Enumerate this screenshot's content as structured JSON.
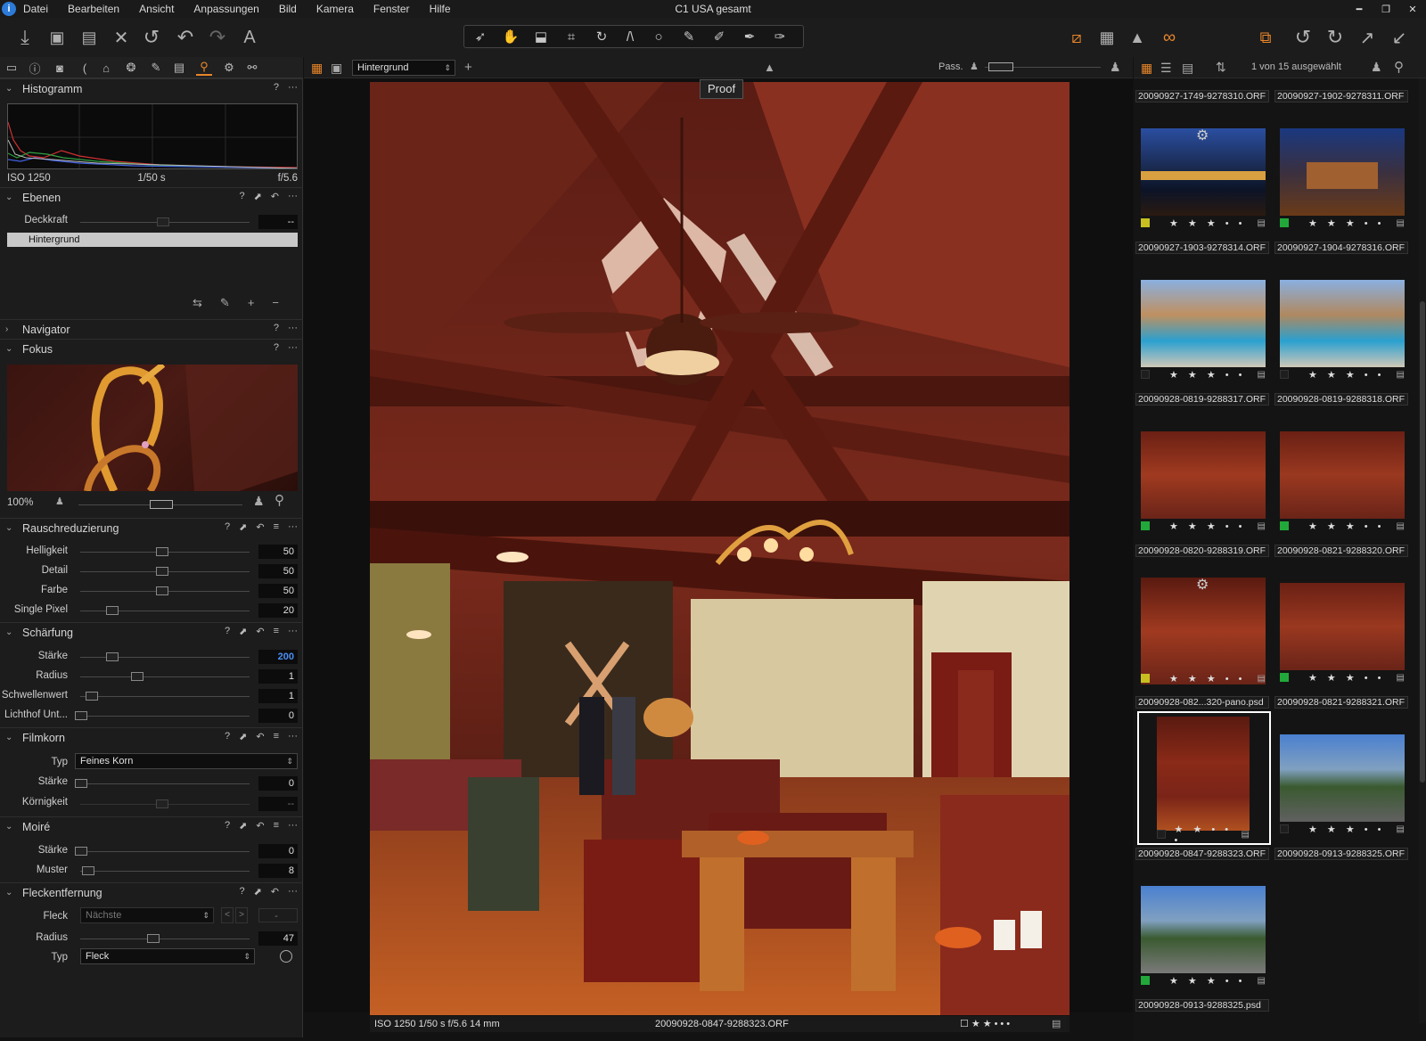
{
  "window": {
    "title": "C1 USA gesamt"
  },
  "menu": [
    "Datei",
    "Bearbeiten",
    "Ansicht",
    "Anpassungen",
    "Bild",
    "Kamera",
    "Fenster",
    "Hilfe"
  ],
  "viewer_bar": {
    "layer_select": "Hintergrund",
    "pass_label": "Pass.",
    "selection_count": "1 von 15 ausgewählt"
  },
  "proof_label": "Proof",
  "histogram": {
    "title": "Histogramm",
    "iso": "ISO 1250",
    "shutter": "1/50 s",
    "aperture": "f/5.6"
  },
  "ebenen": {
    "title": "Ebenen",
    "opacity_label": "Deckkraft",
    "opacity_value": "--",
    "layer": "Hintergrund"
  },
  "navigator": {
    "title": "Navigator"
  },
  "fokus": {
    "title": "Fokus",
    "zoom": "100%"
  },
  "rausch": {
    "title": "Rauschreduzierung",
    "rows": [
      {
        "label": "Helligkeit",
        "value": "50"
      },
      {
        "label": "Detail",
        "value": "50"
      },
      {
        "label": "Farbe",
        "value": "50"
      },
      {
        "label": "Single Pixel",
        "value": "20"
      }
    ]
  },
  "schaerfung": {
    "title": "Schärfung",
    "rows": [
      {
        "label": "Stärke",
        "value": "200"
      },
      {
        "label": "Radius",
        "value": "1"
      },
      {
        "label": "Schwellenwert",
        "value": "1"
      },
      {
        "label": "Lichthof Unt...",
        "value": "0"
      }
    ]
  },
  "filmkorn": {
    "title": "Filmkorn",
    "type_label": "Typ",
    "type_value": "Feines Korn",
    "strength_label": "Stärke",
    "strength_value": "0",
    "grain_label": "Körnigkeit",
    "grain_value": "--"
  },
  "moire": {
    "title": "Moiré",
    "strength_label": "Stärke",
    "strength_value": "0",
    "pattern_label": "Muster",
    "pattern_value": "8"
  },
  "flecken": {
    "title": "Fleckentfernung",
    "fleck_label": "Fleck",
    "fleck_value": "Nächste",
    "fleck_dash": "-",
    "radius_label": "Radius",
    "radius_value": "47",
    "type_label": "Typ",
    "type_value": "Fleck"
  },
  "status": {
    "exif": "ISO 1250  1/50 s  f/5.6  14 mm",
    "filename": "20090928-0847-9288323.ORF"
  },
  "thumbnails": [
    {
      "name": "20090927-1749-9278310.ORF"
    },
    {
      "name": "20090927-1902-9278311.ORF"
    },
    {
      "name": "20090927-1903-9278314.ORF",
      "tag": "#c8c020"
    },
    {
      "name": "20090927-1904-9278316.ORF",
      "tag": "#22a83a"
    },
    {
      "name": "20090928-0819-9288317.ORF",
      "tag": "#1e1e1e"
    },
    {
      "name": "20090928-0819-9288318.ORF",
      "tag": "#1e1e1e"
    },
    {
      "name": "20090928-0820-9288319.ORF",
      "tag": "#22a83a"
    },
    {
      "name": "20090928-0821-9288320.ORF",
      "tag": "#22a83a"
    },
    {
      "name": "20090928-082...320-pano.psd",
      "tag": "#c8c020"
    },
    {
      "name": "20090928-0821-9288321.ORF",
      "tag": "#22a83a"
    },
    {
      "name": "20090928-0847-9288323.ORF",
      "tag": "#1e1e1e"
    },
    {
      "name": "20090928-0913-9288325.ORF",
      "tag": "#1e1e1e"
    },
    {
      "name": "20090928-0913-9288325.psd",
      "tag": "#22a83a"
    }
  ],
  "stars": [
    "★ ★ ★ • •",
    "★ ★ • • •"
  ],
  "colors": {
    "accent": "#e8862a",
    "selection": "#4b8ef2"
  }
}
